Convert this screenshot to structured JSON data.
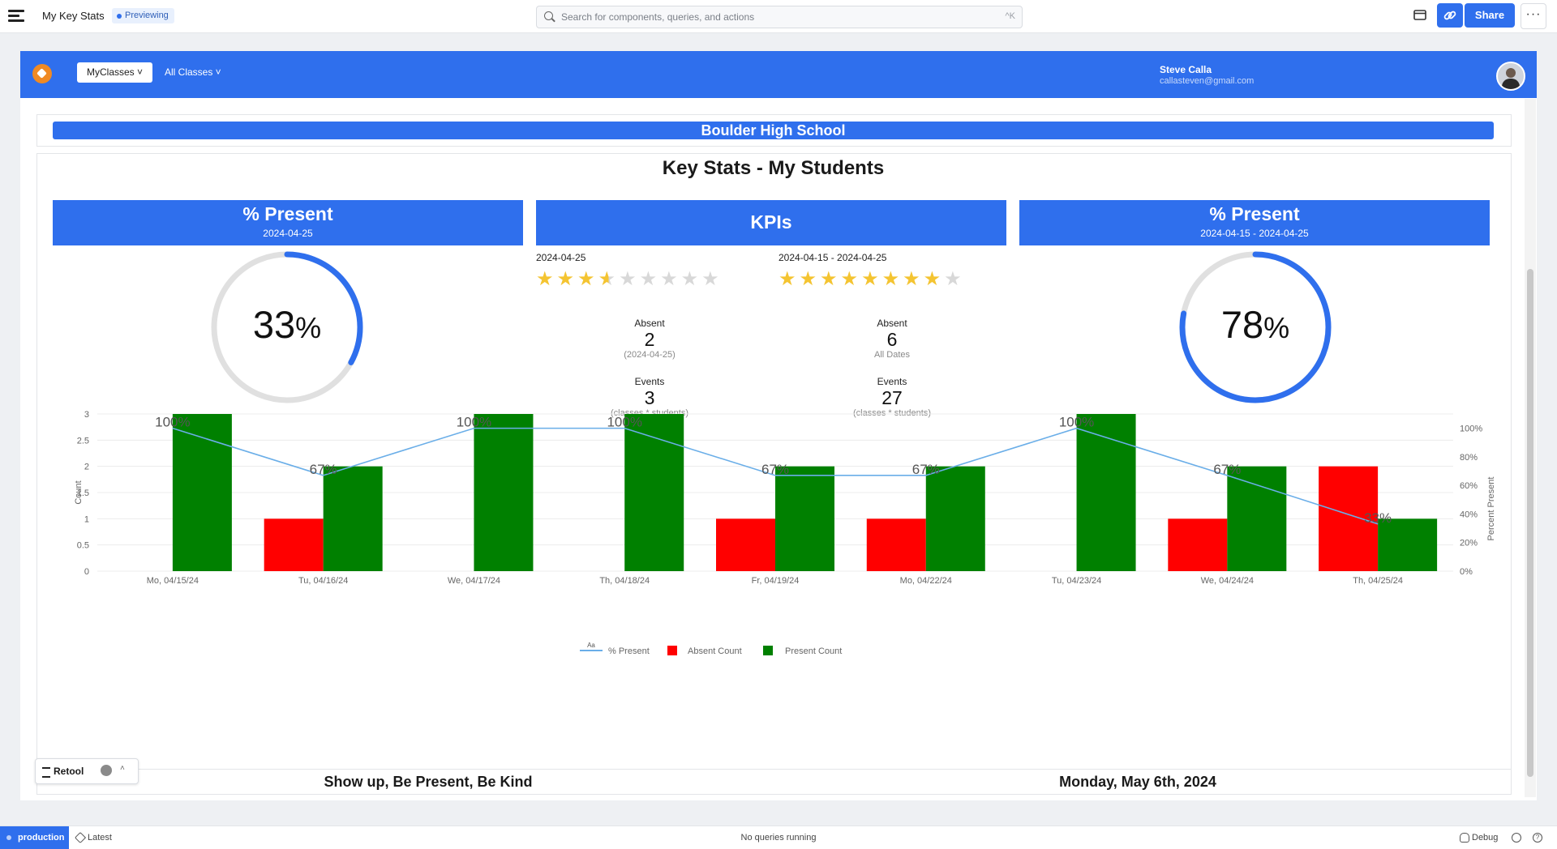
{
  "app": {
    "title": "My Key Stats",
    "mode_badge": "Previewing"
  },
  "search": {
    "placeholder": "Search for components, queries, and actions",
    "shortcut": "^K"
  },
  "toolbar": {
    "share_label": "Share",
    "more_label": "···"
  },
  "header": {
    "nav": [
      {
        "label": "MyClasses ˅"
      },
      {
        "label": "All Classes ˅"
      }
    ],
    "user": {
      "name": "Steve Calla",
      "email": "callasteven@gmail.com"
    }
  },
  "school": {
    "name": "Boulder High School"
  },
  "page_title": "Key Stats - My Students",
  "cards": {
    "left": {
      "title": "% Present",
      "subtitle": "2024-04-25",
      "value": "33",
      "unit": "%",
      "fraction": 0.33
    },
    "center": {
      "title": "KPIs"
    },
    "right": {
      "title": "% Present",
      "subtitle": "2024-04-15 - 2024-04-25",
      "value": "78",
      "unit": "%",
      "fraction": 0.78
    }
  },
  "kpis": {
    "day": {
      "date": "2024-04-25",
      "rating": 3.5,
      "max": 9,
      "absent_label": "Absent",
      "absent_value": "2",
      "absent_sub": "(2024-04-25)",
      "events_label": "Events",
      "events_value": "3",
      "events_sub": "(classes * students)"
    },
    "range": {
      "date": "2024-04-15 - 2024-04-25",
      "rating": 8,
      "max": 9,
      "absent_label": "Absent",
      "absent_value": "6",
      "absent_sub": "All Dates",
      "events_label": "Events",
      "events_value": "27",
      "events_sub": "(classes * students)"
    }
  },
  "colors": {
    "accent": "#2f6fed",
    "absent": "#ff0000",
    "present": "#008000",
    "line": "#6aaee8",
    "star": "#f4c431"
  },
  "chart_data": {
    "type": "bar",
    "categories": [
      "Mo, 04/15/24",
      "Tu, 04/16/24",
      "We, 04/17/24",
      "Th, 04/18/24",
      "Fr, 04/19/24",
      "Mo, 04/22/24",
      "Tu, 04/23/24",
      "We, 04/24/24",
      "Th, 04/25/24"
    ],
    "series": [
      {
        "name": "Absent Count",
        "type": "bar",
        "axis": "left",
        "color": "#ff0000",
        "values": [
          0,
          1,
          0,
          0,
          1,
          1,
          0,
          1,
          2
        ]
      },
      {
        "name": "Present Count",
        "type": "bar",
        "axis": "left",
        "color": "#008000",
        "values": [
          3,
          2,
          3,
          3,
          2,
          2,
          3,
          2,
          1
        ]
      },
      {
        "name": "% Present",
        "type": "line",
        "axis": "right",
        "color": "#6aaee8",
        "values": [
          100,
          67,
          100,
          100,
          67,
          67,
          100,
          67,
          33
        ],
        "labels": [
          "100%",
          "67%",
          "100%",
          "100%",
          "67%",
          "67%",
          "100%",
          "67%",
          "33%"
        ]
      }
    ],
    "ylabel": "Count",
    "ylabel_right": "Percent Present",
    "ylim": [
      0,
      3
    ],
    "ylim_right": [
      0,
      110
    ],
    "yticks": [
      "0",
      "0.5",
      "1",
      "1.5",
      "2",
      "2.5",
      "3"
    ],
    "yticks_right": [
      "0%",
      "20%",
      "40%",
      "60%",
      "80%",
      "100%"
    ],
    "legend_position": "bottom-center",
    "legend_line_glyph": "Aa",
    "grid": true
  },
  "footer": {
    "motto": "Show up, Be Present, Be Kind",
    "date": "Monday, May 6th, 2024"
  },
  "retool_pill": {
    "label": "Retool",
    "chevron": "˄"
  },
  "statusbar": {
    "env": "production",
    "release": "Latest",
    "queries": "No queries running",
    "debug": "Debug"
  }
}
